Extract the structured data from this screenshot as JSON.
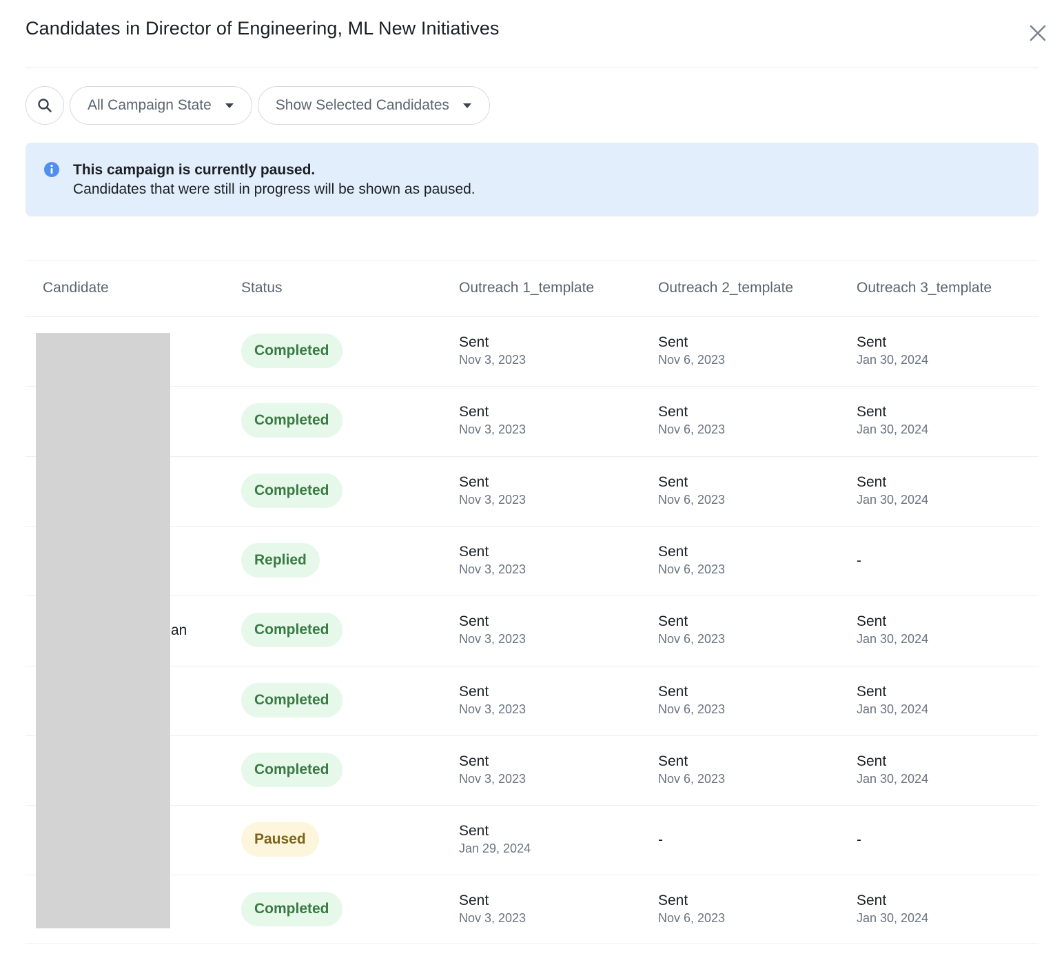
{
  "dialog": {
    "title": "Candidates in Director of Engineering, ML New Initiatives"
  },
  "filters": {
    "campaign_state": "All Campaign State",
    "selected_candidates": "Show Selected Candidates"
  },
  "banner": {
    "title": "This campaign is currently paused.",
    "text": "Candidates that were still in progress will be shown as paused.",
    "color": "#e3eefc"
  },
  "table": {
    "columns": {
      "candidate": "Candidate",
      "status": "Status",
      "outreach1": "Outreach 1_template",
      "outreach2": "Outreach 2_template",
      "outreach3": "Outreach 3_template"
    },
    "rows": [
      {
        "name": "",
        "status": "Completed",
        "o1": {
          "state": "Sent",
          "date": "Nov 3, 2023"
        },
        "o2": {
          "state": "Sent",
          "date": "Nov 6, 2023"
        },
        "o3": {
          "state": "Sent",
          "date": "Jan 30, 2024"
        }
      },
      {
        "name": "",
        "status": "Completed",
        "o1": {
          "state": "Sent",
          "date": "Nov 3, 2023"
        },
        "o2": {
          "state": "Sent",
          "date": "Nov 6, 2023"
        },
        "o3": {
          "state": "Sent",
          "date": "Jan 30, 2024"
        }
      },
      {
        "name": "",
        "status": "Completed",
        "o1": {
          "state": "Sent",
          "date": "Nov 3, 2023"
        },
        "o2": {
          "state": "Sent",
          "date": "Nov 6, 2023"
        },
        "o3": {
          "state": "Sent",
          "date": "Jan 30, 2024"
        }
      },
      {
        "name": "",
        "status": "Replied",
        "o1": {
          "state": "Sent",
          "date": "Nov 3, 2023"
        },
        "o2": {
          "state": "Sent",
          "date": "Nov 6, 2023"
        },
        "o3": {
          "dash": "-"
        }
      },
      {
        "name": "an",
        "status": "Completed",
        "o1": {
          "state": "Sent",
          "date": "Nov 3, 2023"
        },
        "o2": {
          "state": "Sent",
          "date": "Nov 6, 2023"
        },
        "o3": {
          "state": "Sent",
          "date": "Jan 30, 2024"
        }
      },
      {
        "name": "",
        "status": "Completed",
        "o1": {
          "state": "Sent",
          "date": "Nov 3, 2023"
        },
        "o2": {
          "state": "Sent",
          "date": "Nov 6, 2023"
        },
        "o3": {
          "state": "Sent",
          "date": "Jan 30, 2024"
        }
      },
      {
        "name": "",
        "status": "Completed",
        "o1": {
          "state": "Sent",
          "date": "Nov 3, 2023"
        },
        "o2": {
          "state": "Sent",
          "date": "Nov 6, 2023"
        },
        "o3": {
          "state": "Sent",
          "date": "Jan 30, 2024"
        }
      },
      {
        "name": "",
        "status": "Paused",
        "o1": {
          "state": "Sent",
          "date": "Jan 29, 2024"
        },
        "o2": {
          "dash": "-"
        },
        "o3": {
          "dash": "-"
        }
      },
      {
        "name": "",
        "status": "Completed",
        "o1": {
          "state": "Sent",
          "date": "Nov 3, 2023"
        },
        "o2": {
          "state": "Sent",
          "date": "Nov 6, 2023"
        },
        "o3": {
          "state": "Sent",
          "date": "Jan 30, 2024"
        }
      }
    ]
  },
  "colors": {
    "completed_bg": "#e6f8ea",
    "completed_text": "#3a7a43",
    "paused_bg": "#fdf6dc",
    "paused_text": "#7d6318",
    "redaction": "#d3d3d3"
  },
  "icons": {
    "search": "search-icon",
    "close": "close-icon",
    "info": "info-icon",
    "caret": "caret-down-icon"
  }
}
